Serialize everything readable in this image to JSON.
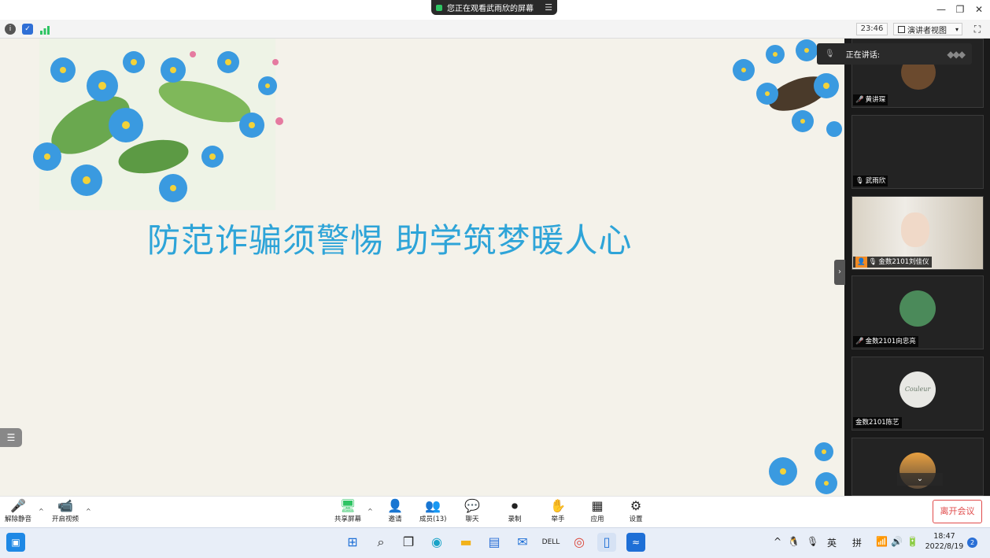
{
  "share_banner": {
    "text": "您正在观看武雨欣的屏幕",
    "menu_icon": "menu-lines-icon"
  },
  "window_controls": {
    "minimize": "—",
    "restore": "❐",
    "close": "✕"
  },
  "meeting_bar": {
    "clock": "23:46",
    "view_label": "演讲者视图",
    "caret": "▾",
    "fullscreen_icon": "⛶"
  },
  "slide": {
    "title": "防范诈骗须警惕 助学筑梦暖人心",
    "list_icon": "☰"
  },
  "speaking": {
    "label": "正在讲话:",
    "dots": "◆◆◆"
  },
  "participants": [
    {
      "name": "黄讲琛",
      "muted": true
    },
    {
      "name": "武雨欣",
      "muted": false
    },
    {
      "name": "金数2101刘佳仪",
      "muted": false,
      "host": true
    },
    {
      "name": "金数2101向忠亮",
      "muted": true
    },
    {
      "name": "金数2101陈艺",
      "muted": false,
      "avatar_text": "Couleur"
    },
    {
      "name": "",
      "muted": false
    }
  ],
  "panel": {
    "collapse_icon": "›",
    "scroll_down_icon": "⌄"
  },
  "controls": {
    "unmute": "解除静音",
    "start_video": "开启视频",
    "share_screen": "共享屏幕",
    "invite": "邀请",
    "participants": "成员(13)",
    "chat": "聊天",
    "record": "录制",
    "raise_hand": "举手",
    "apps": "应用",
    "settings": "设置",
    "leave": "离开会议",
    "caret_up": "^"
  },
  "taskbar": {
    "tray_caret": "^",
    "ime_lang": "英",
    "ime_mode": "拼",
    "time": "18:47",
    "date": "2022/8/19",
    "notifications": "2"
  },
  "colors": {
    "accent": "#2ea4d8",
    "leave": "#e04a4a",
    "speaking_bg": "#2a2a2a"
  }
}
